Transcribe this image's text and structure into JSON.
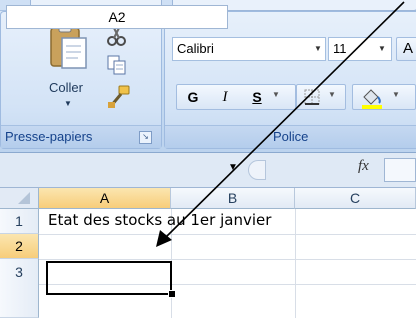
{
  "clipboard": {
    "paste_label": "Coller",
    "group_label": "Presse-papiers",
    "icons": [
      "paste-icon",
      "cut-icon",
      "copy-icon",
      "format-painter-icon"
    ]
  },
  "font": {
    "group_label": "Police",
    "font_name": "Calibri",
    "font_size": "11",
    "grow_label": "A",
    "bold_label": "G",
    "italic_label": "I",
    "underline_label": "S"
  },
  "formula_bar": {
    "name_box": "A2",
    "fx_label": "fx"
  },
  "sheet": {
    "columns": [
      "A",
      "B",
      "C"
    ],
    "rows": [
      "1",
      "2",
      "3"
    ],
    "a1": "Etat des stocks au 1er janvier",
    "active_cell": "A2"
  },
  "colors": {
    "ribbon": "#c6dbf2",
    "group_text": "#15428b",
    "selected_header": "#f7cd7a"
  }
}
